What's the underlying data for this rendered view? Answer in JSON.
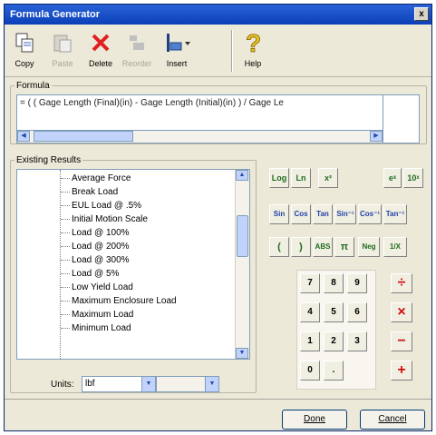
{
  "window": {
    "title": "Formula Generator",
    "close_glyph": "x"
  },
  "toolbar": {
    "copy": "Copy",
    "paste": "Paste",
    "delete": "Delete",
    "rearrange": "Reorder",
    "insert": "Insert",
    "help": "Help"
  },
  "formula": {
    "legend": "Formula",
    "text": "= ( ( Gage Length (Final)(in) - Gage Length (Initial)(in) ) / Gage Le"
  },
  "results": {
    "legend": "Existing Results",
    "items": [
      "Average Force",
      "Break Load",
      "EUL Load @ .5%",
      "Initial Motion Scale",
      "Load @ 100%",
      "Load @ 200%",
      "Load @ 300%",
      "Load @ 5%",
      "Low Yield Load",
      "Maximum Enclosure Load",
      "Maximum Load",
      "Minimum Load"
    ]
  },
  "units": {
    "label": "Units:",
    "value": "lbf",
    "value2": ""
  },
  "calc": {
    "row1": [
      "Log",
      "Ln",
      "x²",
      "eˣ",
      "10ˣ"
    ],
    "row2": [
      "Sin",
      "Cos",
      "Tan",
      "Sin⁻¹",
      "Cos⁻¹",
      "Tan⁻¹"
    ],
    "row3": [
      "(",
      ")",
      "ABS",
      "π",
      "Neg",
      "1/X"
    ],
    "digits": [
      "7",
      "8",
      "9",
      "4",
      "5",
      "6",
      "1",
      "2",
      "3",
      "0",
      "."
    ],
    "ops": [
      "÷",
      "×",
      "−",
      "+"
    ]
  },
  "buttons": {
    "done": "Done",
    "cancel": "Cancel"
  },
  "colors": {
    "accent": "#0b3fb8",
    "op": "#d01010",
    "fn": "#1f6b1f",
    "trig": "#1f3fa8"
  }
}
